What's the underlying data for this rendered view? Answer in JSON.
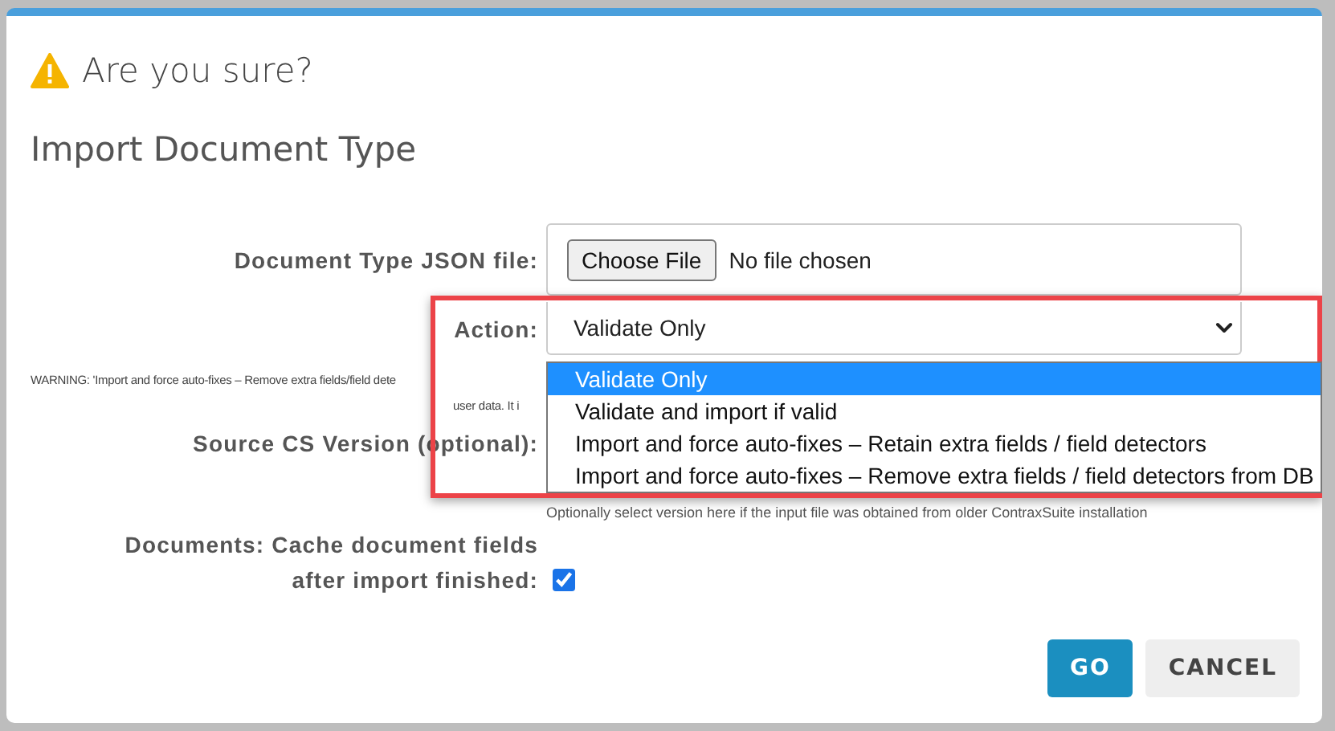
{
  "dialog": {
    "title": "Are you sure?",
    "heading": "Import Document Type",
    "file_field": {
      "label": "Document Type JSON file:",
      "button": "Choose File",
      "value": "No file chosen"
    },
    "action_field": {
      "label": "Action:",
      "value": "Validate Only",
      "expanded": true
    },
    "warning_lines": [
      "WARNING: 'Import and force auto-fixes – Remove extra fields/field dete",
      "user data. It i"
    ],
    "version_field": {
      "label": "Source CS Version (optional):",
      "hint": "Optionally select version here if the input file was obtained from older ContraxSuite installation"
    },
    "cache_field": {
      "label": "Documents: Cache document fields after import finished:",
      "checked": true
    },
    "dropdown": {
      "options": [
        {
          "label": "Validate Only",
          "selected": true
        },
        {
          "label": "Validate and import if valid",
          "selected": false
        },
        {
          "label": "Import and force auto-fixes – Retain extra fields / field detectors",
          "selected": false
        },
        {
          "label": "Import and force auto-fixes – Remove extra fields / field detectors from DB",
          "selected": false
        }
      ]
    },
    "buttons": [
      {
        "label": "GO",
        "kind": "primary"
      },
      {
        "label": "CANCEL",
        "kind": "secondary"
      }
    ]
  }
}
